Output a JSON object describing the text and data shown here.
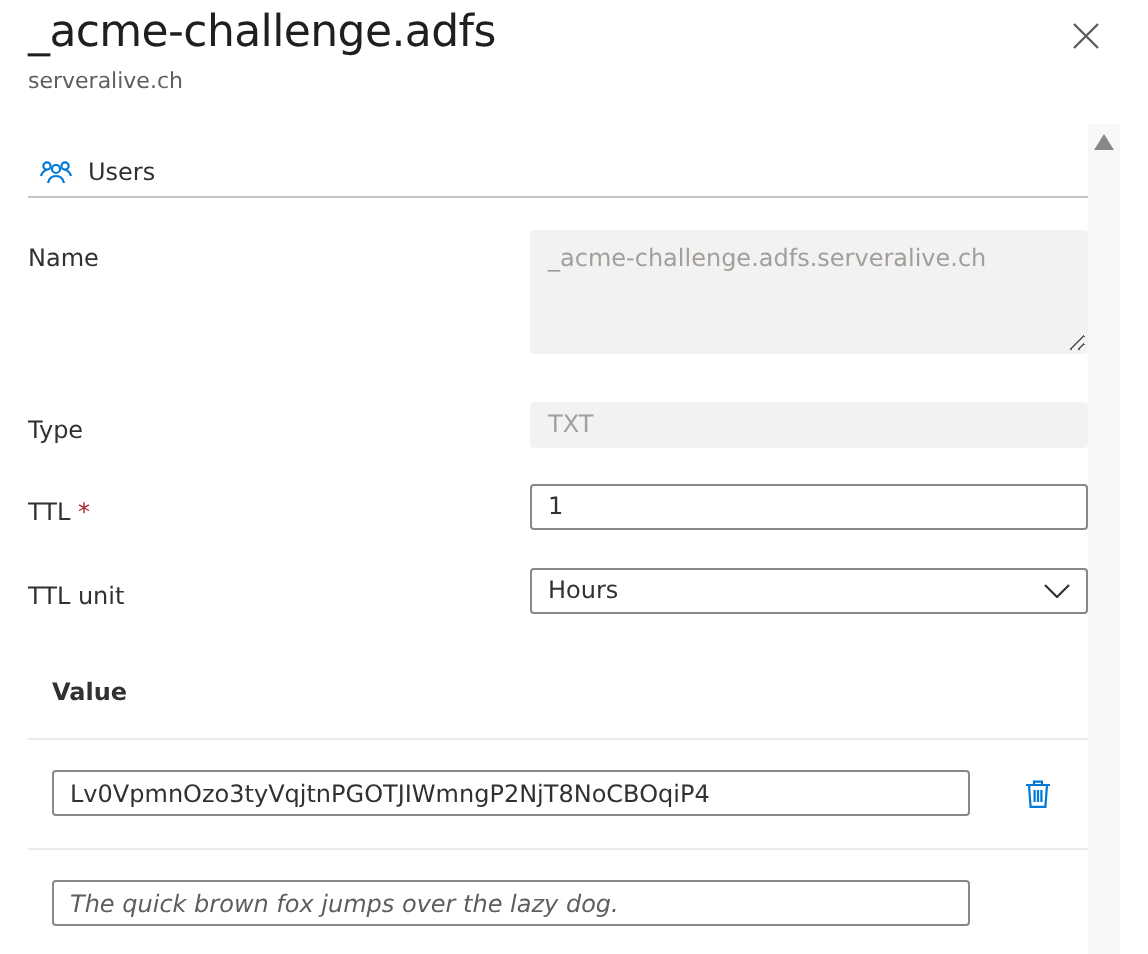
{
  "panel": {
    "title": "_acme-challenge.adfs",
    "subtitle": "serveralive.ch"
  },
  "tabs": [
    {
      "label": "Users"
    }
  ],
  "fields": [
    {
      "kind": "textarea",
      "label": "Name",
      "value": "_acme-challenge.adfs.serveralive.ch",
      "disabled": true
    },
    {
      "kind": "text",
      "label": "Type",
      "value": "TXT",
      "disabled": true
    },
    {
      "kind": "text",
      "label": "TTL",
      "required_mark": "*",
      "value": "1",
      "disabled": false
    },
    {
      "kind": "select",
      "label": "TTL unit",
      "value": "Hours",
      "disabled": false
    }
  ],
  "values": {
    "heading": "Value",
    "rows": [
      {
        "kind": "entry",
        "value": "Lv0VpmnOzo3tyVqjtnPGOTJIWmngP2NjT8NoCBOqiP4"
      },
      {
        "kind": "new",
        "placeholder": "The quick brown fox jumps over the lazy dog."
      }
    ]
  }
}
